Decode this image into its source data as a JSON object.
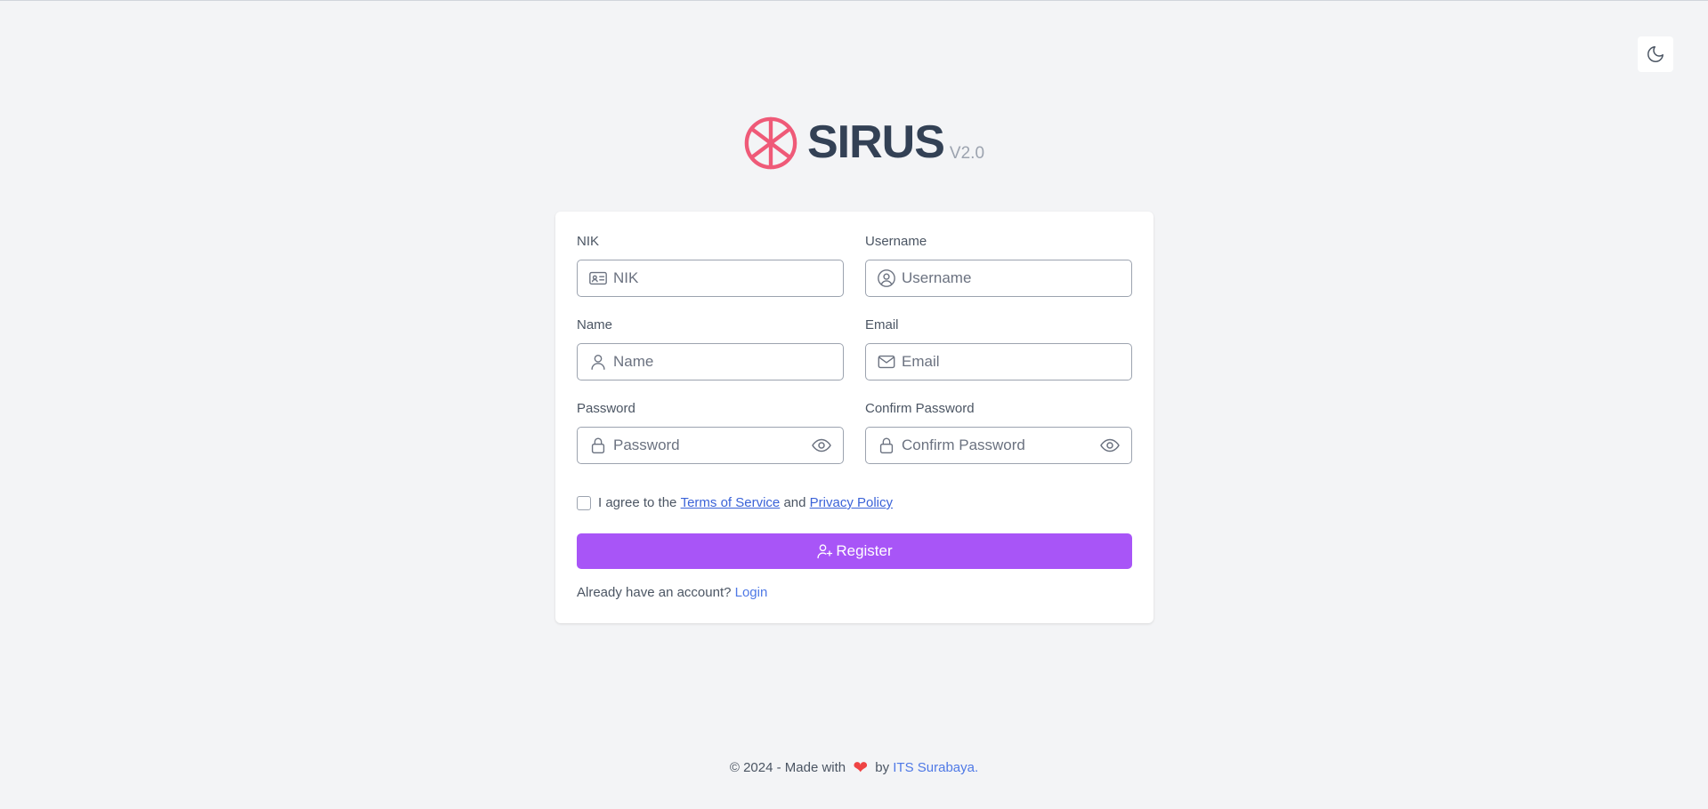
{
  "brand": {
    "name": "SIRUS",
    "version": "V2.0",
    "logo_color": "#ef5a78"
  },
  "theme_toggle": {
    "icon": "moon-icon"
  },
  "form": {
    "nik": {
      "label": "NIK",
      "placeholder": "NIK",
      "value": "",
      "icon": "id-card-icon"
    },
    "username": {
      "label": "Username",
      "placeholder": "Username",
      "value": "",
      "icon": "user-circle-icon"
    },
    "name": {
      "label": "Name",
      "placeholder": "Name",
      "value": "",
      "icon": "user-icon"
    },
    "email": {
      "label": "Email",
      "placeholder": "Email",
      "value": "",
      "icon": "mail-icon"
    },
    "password": {
      "label": "Password",
      "placeholder": "Password",
      "value": "",
      "icon": "lock-icon"
    },
    "confirm_password": {
      "label": "Confirm Password",
      "placeholder": "Confirm Password",
      "value": "",
      "icon": "lock-icon"
    },
    "agree": {
      "prefix": "I agree to the ",
      "terms": "Terms of Service",
      "middle": " and ",
      "privacy": "Privacy Policy",
      "checked": false
    },
    "register_label": "Register",
    "login_prompt": "Already have an account? ",
    "login_link": "Login"
  },
  "colors": {
    "accent": "#a855f7",
    "link": "#3b63d8",
    "background": "#f3f4f6"
  },
  "footer": {
    "prefix": "© 2024 - Made with",
    "by": "by",
    "org": "ITS Surabaya."
  }
}
